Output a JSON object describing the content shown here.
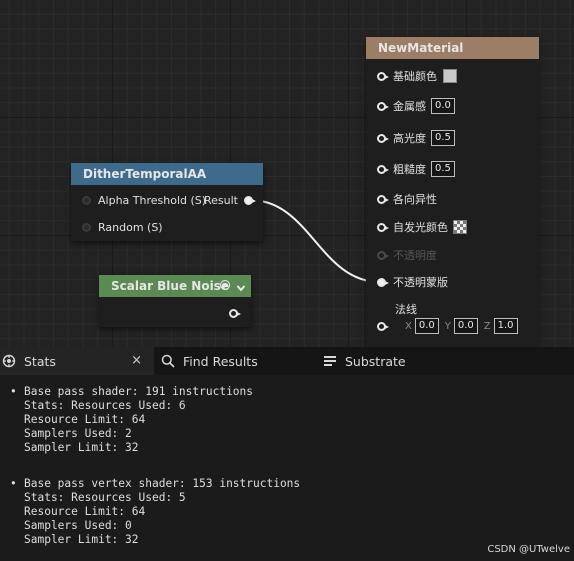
{
  "graph": {
    "dither_node": {
      "title": "DitherTemporalAA",
      "header_color": "#3e6a8c",
      "inputs": [
        "Alpha Threshold (S)",
        "Random (S)"
      ],
      "output": "Result"
    },
    "blue_noise_node": {
      "title": "Scalar Blue Noise",
      "header_color": "#5b8a52"
    },
    "material_node": {
      "title": "NewMaterial",
      "header_color": "#9c7d66",
      "pins": {
        "base_color": "基础颜色",
        "metallic": "金属感",
        "metallic_value": "0.0",
        "specular": "高光度",
        "specular_value": "0.5",
        "roughness": "粗糙度",
        "roughness_value": "0.5",
        "anisotropy": "各向异性",
        "emissive": "自发光颜色",
        "opacity": "不透明度",
        "opacity_mask": "不透明蒙版",
        "normal": "法线",
        "normal_x_label": "X",
        "normal_x": "0.0",
        "normal_y_label": "Y",
        "normal_y": "0.0",
        "normal_z_label": "Z",
        "normal_z": "1.0"
      }
    }
  },
  "tabs": [
    {
      "label": "Stats",
      "icon": "stats-icon",
      "active": true
    },
    {
      "label": "Find Results",
      "icon": "search-icon",
      "active": false
    },
    {
      "label": "Substrate",
      "icon": "list-icon",
      "active": false
    }
  ],
  "tab_close": "×",
  "stats": {
    "pixel_shader": [
      "Base pass shader: 191 instructions",
      "Stats: Resources Used: 6",
      "Resource Limit: 64",
      "Samplers Used: 2",
      "Sampler Limit: 32"
    ],
    "vertex_shader": [
      "Base pass vertex shader: 153 instructions",
      "Stats: Resources Used: 5",
      "Resource Limit: 64",
      "Samplers Used: 0",
      "Sampler Limit: 32"
    ]
  },
  "watermark": "CSDN @UTwelve"
}
